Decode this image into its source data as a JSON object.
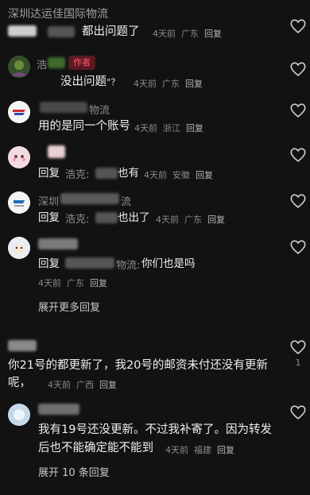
{
  "top": {
    "name": "深圳达运佳国际物流",
    "text": "都出问题了",
    "time": "4天前",
    "loc": "广东",
    "reply": "回复"
  },
  "c1": {
    "name": "浩",
    "tag": "作者",
    "text": "没出问题",
    "tail": "°？",
    "time": "4天前",
    "loc": "广东",
    "reply": "回复"
  },
  "c2": {
    "name_tail": "物流",
    "text": "用的是同一个账号",
    "time": "4天前",
    "loc": "浙江",
    "reply": "回复"
  },
  "c3": {
    "prefix": "回复",
    "to": "浩克:",
    "text": "也有",
    "time": "4天前",
    "loc": "安徽",
    "reply": "回复"
  },
  "c4": {
    "name": "深圳",
    "name_tail": "流",
    "prefix": "回复",
    "to": "浩克:",
    "text": "也出了",
    "time": "4天前",
    "loc": "广东",
    "reply": "回复"
  },
  "c5": {
    "prefix": "回复",
    "to_tail": "物流:",
    "text": "你们也是吗",
    "time": "4天前",
    "loc": "广东",
    "reply": "回复"
  },
  "more1": "展开更多回复",
  "c6": {
    "text": "你21号的都更新了，我20号的邮资未付还没有更新呢，",
    "time": "4天前",
    "loc": "广西",
    "reply": "回复",
    "likes": "1"
  },
  "c7": {
    "text": "我有19号还没更新。不过我补寄了。因为转发后也不能确定能不能到",
    "time": "4天前",
    "loc": "福建",
    "reply": "回复"
  },
  "more2": "展开 10 条回复"
}
